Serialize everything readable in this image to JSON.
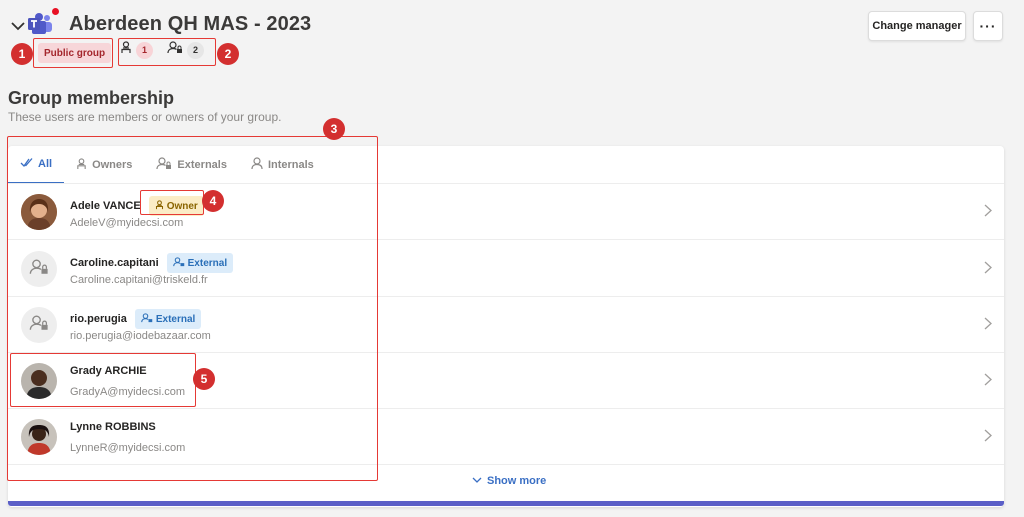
{
  "header": {
    "title": "Aberdeen QH MAS - 2023",
    "public_badge": "Public group",
    "owner_count": "1",
    "external_count": "2",
    "change_manager_label": "Change manager",
    "more_label": "···"
  },
  "section": {
    "title": "Group membership",
    "subtitle": "These users are members or owners of your group."
  },
  "tabs": [
    {
      "label": "All",
      "icon": "check-icon"
    },
    {
      "label": "Owners",
      "icon": "owner-icon"
    },
    {
      "label": "Externals",
      "icon": "external-user-icon"
    },
    {
      "label": "Internals",
      "icon": "user-icon"
    }
  ],
  "members": [
    {
      "name": "Adele VANCE",
      "email": "AdeleV@myidecsi.com",
      "tag": "Owner",
      "avatar": "photo"
    },
    {
      "name": "Caroline.capitani",
      "email": "Caroline.capitani@triskeld.fr",
      "tag": "External",
      "avatar": "placeholder"
    },
    {
      "name": "rio.perugia",
      "email": "rio.perugia@iodebazaar.com",
      "tag": "External",
      "avatar": "placeholder"
    },
    {
      "name": "Grady ARCHIE",
      "email": "GradyA@myidecsi.com",
      "tag": "",
      "avatar": "photo"
    },
    {
      "name": "Lynne ROBBINS",
      "email": "LynneR@myidecsi.com",
      "tag": "",
      "avatar": "photo"
    }
  ],
  "show_more_label": "Show more",
  "annotations": [
    "1",
    "2",
    "3",
    "4",
    "5"
  ],
  "colors": {
    "accent": "#3a6fc4",
    "annotation": "#d32f2f",
    "brand_bar": "#5b5fc7"
  }
}
